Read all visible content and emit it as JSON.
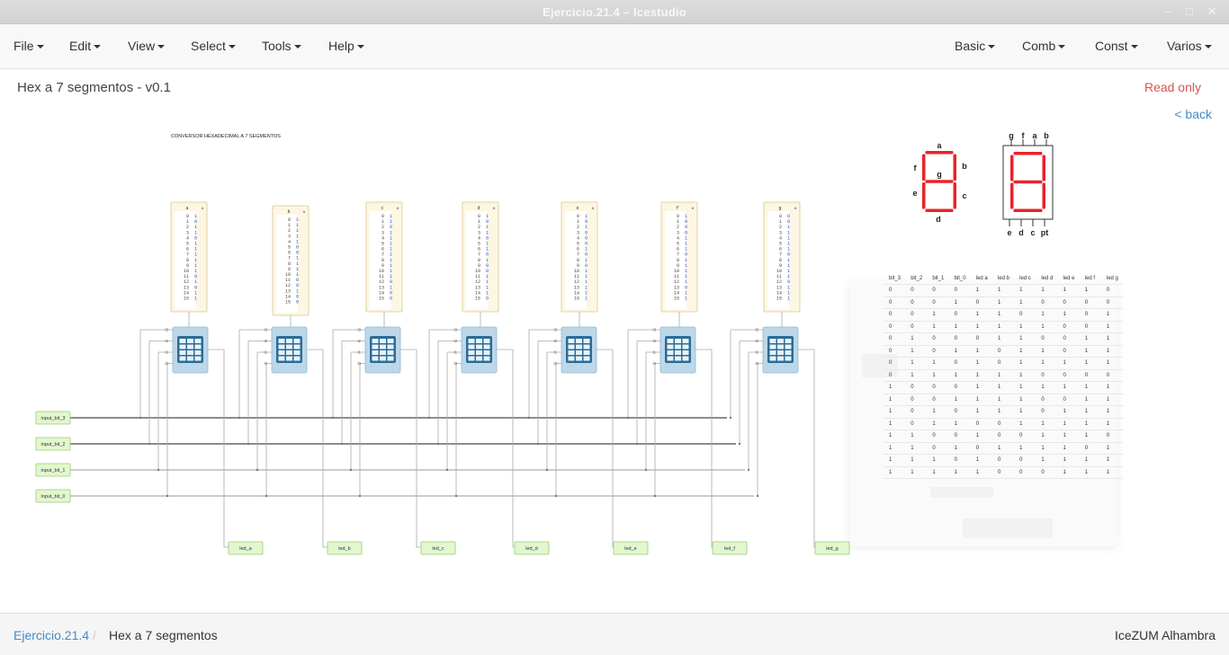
{
  "window": {
    "title": "Ejercicio.21.4 – Icestudio"
  },
  "menu_left": [
    "File",
    "Edit",
    "View",
    "Select",
    "Tools",
    "Help"
  ],
  "menu_right": [
    "Basic",
    "Comb",
    "Const",
    "Varios"
  ],
  "project": {
    "title": "Hex a 7 segmentos - v0.1",
    "status": "Read only",
    "back": "< back"
  },
  "diagram": {
    "comment": "CONVERSOR HEXADECIMAL A 7 SEGMENTOS",
    "inputs": [
      "input_bit_3",
      "input_bit_2",
      "input_bit_1",
      "input_bit_0"
    ],
    "outputs": [
      "led_a",
      "led_b",
      "led_c",
      "led_d",
      "led_e",
      "led_f",
      "led_g"
    ],
    "port_labels": [
      "i3",
      "i2",
      "i1",
      "i0"
    ],
    "tables": [
      {
        "name": "a",
        "bits": [
          1,
          0,
          1,
          1,
          0,
          1,
          1,
          1,
          1,
          1,
          1,
          0,
          1,
          0,
          1,
          1
        ]
      },
      {
        "name": "b",
        "bits": [
          1,
          1,
          1,
          1,
          1,
          0,
          0,
          1,
          1,
          1,
          1,
          0,
          0,
          1,
          0,
          0
        ]
      },
      {
        "name": "c",
        "bits": [
          1,
          1,
          0,
          1,
          1,
          1,
          1,
          1,
          1,
          1,
          1,
          1,
          0,
          1,
          0,
          0
        ]
      },
      {
        "name": "d",
        "bits": [
          1,
          0,
          1,
          1,
          0,
          1,
          1,
          0,
          1,
          0,
          0,
          1,
          1,
          1,
          1,
          0
        ]
      },
      {
        "name": "e",
        "bits": [
          1,
          0,
          1,
          0,
          0,
          0,
          1,
          0,
          1,
          0,
          1,
          1,
          1,
          1,
          1,
          1
        ]
      },
      {
        "name": "f",
        "bits": [
          1,
          0,
          0,
          0,
          1,
          1,
          1,
          0,
          1,
          1,
          1,
          1,
          1,
          0,
          1,
          1
        ]
      },
      {
        "name": "g",
        "bits": [
          0,
          0,
          1,
          1,
          1,
          1,
          1,
          0,
          1,
          1,
          1,
          1,
          0,
          1,
          1,
          1
        ]
      }
    ]
  },
  "segments": {
    "left_labels": [
      "a",
      "b",
      "c",
      "d",
      "e",
      "f",
      "g"
    ],
    "top_pins": [
      "g",
      "f",
      "a",
      "b"
    ],
    "bottom_pins": [
      "e",
      "d",
      "c",
      "pt"
    ]
  },
  "truth_table": {
    "headers": [
      "bit_3",
      "bit_2",
      "bit_1",
      "bit_0",
      "led a",
      "led b",
      "led c",
      "led d",
      "led e",
      "led f",
      "led g"
    ],
    "rows": [
      [
        "0",
        "0",
        "0",
        "0",
        "1",
        "1",
        "1",
        "1",
        "1",
        "1",
        "0"
      ],
      [
        "0",
        "0",
        "0",
        "1",
        "0",
        "1",
        "1",
        "0",
        "0",
        "0",
        "0"
      ],
      [
        "0",
        "0",
        "1",
        "0",
        "1",
        "1",
        "0",
        "1",
        "1",
        "0",
        "1"
      ],
      [
        "0",
        "0",
        "1",
        "1",
        "1",
        "1",
        "1",
        "1",
        "0",
        "0",
        "1"
      ],
      [
        "0",
        "1",
        "0",
        "0",
        "0",
        "1",
        "1",
        "0",
        "0",
        "1",
        "1"
      ],
      [
        "0",
        "1",
        "0",
        "1",
        "1",
        "0",
        "1",
        "1",
        "0",
        "1",
        "1"
      ],
      [
        "0",
        "1",
        "1",
        "0",
        "1",
        "0",
        "1",
        "1",
        "1",
        "1",
        "1"
      ],
      [
        "0",
        "1",
        "1",
        "1",
        "1",
        "1",
        "1",
        "0",
        "0",
        "0",
        "0"
      ],
      [
        "1",
        "0",
        "0",
        "0",
        "1",
        "1",
        "1",
        "1",
        "1",
        "1",
        "1"
      ],
      [
        "1",
        "0",
        "0",
        "1",
        "1",
        "1",
        "1",
        "0",
        "0",
        "1",
        "1"
      ],
      [
        "1",
        "0",
        "1",
        "0",
        "1",
        "1",
        "1",
        "0",
        "1",
        "1",
        "1"
      ],
      [
        "1",
        "0",
        "1",
        "1",
        "0",
        "0",
        "1",
        "1",
        "1",
        "1",
        "1"
      ],
      [
        "1",
        "1",
        "0",
        "0",
        "1",
        "0",
        "0",
        "1",
        "1",
        "1",
        "0"
      ],
      [
        "1",
        "1",
        "0",
        "1",
        "0",
        "1",
        "1",
        "1",
        "1",
        "0",
        "1"
      ],
      [
        "1",
        "1",
        "1",
        "0",
        "1",
        "0",
        "0",
        "1",
        "1",
        "1",
        "1"
      ],
      [
        "1",
        "1",
        "1",
        "1",
        "1",
        "0",
        "0",
        "0",
        "1",
        "1",
        "1"
      ]
    ]
  },
  "footer": {
    "crumb_project": "Ejercicio.21.4",
    "crumb_separator": "/",
    "crumb_current": "Hex a 7 segmentos",
    "board": "IceZUM Alhambra"
  },
  "colors": {
    "accent_link": "#428bca",
    "read_only": "#d9534f",
    "segment_red": "#e8232b",
    "io_block": "#e2f7cf",
    "io_border": "#9ccb6e",
    "memory_bg": "#fdf6e3",
    "table_block": "#bcd7e8"
  }
}
